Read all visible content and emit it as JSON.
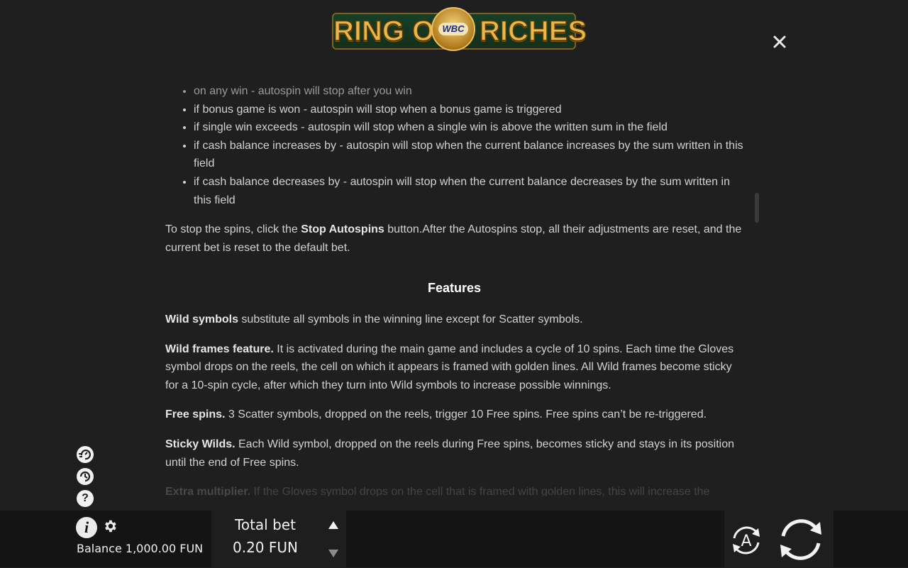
{
  "logo": {
    "left_text": "RING OF",
    "right_text": "RICHES",
    "badge_text": "WBC"
  },
  "close_icon": "close-icon",
  "rules": {
    "autospin_stop_conditions": [
      "on any win - autospin will stop after you win",
      "if bonus game is won - autospin will stop when a bonus game is triggered",
      "if single win exceeds - autospin will stop when a single win is above the written sum in the field",
      "if cash balance increases by - autospin will stop when the current balance increases by the sum written in this field",
      "if cash balance decreases by - autospin will stop when the current balance decreases by the sum written in this field"
    ],
    "stop_text_1": "To stop the spins, click the ",
    "stop_bold": "Stop Autospins",
    "stop_text_2": " button.After the Autospins stop, all their adjustments are reset, and the current bet is reset to the default bet.",
    "features_heading": "Features",
    "wild_bold": "Wild symbols",
    "wild_text": " substitute all symbols in the winning line except for Scatter symbols.",
    "frames_bold": "Wild frames feature.",
    "frames_text": " It is activated during the main game and includes a cycle of 10 spins. Each time the Gloves symbol drops on the reels, the cell on which it appears is framed with golden lines. All Wild frames become sticky for a 10-spin cycle, after which they turn into Wild symbols to increase possible winnings.",
    "free_bold": "Free spins.",
    "free_text": " 3 Scatter symbols, dropped on the reels, trigger 10 Free spins. Free spins can’t be re-triggered.",
    "sticky_bold": "Sticky Wilds.",
    "sticky_text": " Each Wild symbol, dropped on the reels during Free spins, becomes sticky and stays in its position until the end of Free spins.",
    "multi_bold": "Extra multiplier.",
    "multi_text": " If the Gloves symbol drops on the cell that is framed with golden lines, this will increase the"
  },
  "side_icons": {
    "turbo": "turbo-icon",
    "quickspin": "quickspin-icon",
    "help": "?"
  },
  "bottom": {
    "info_label": "i",
    "balance_text": "Balance 1,000.00 FUN",
    "bet_label": "Total bet",
    "bet_value": "0.20 FUN",
    "auto_label": "A"
  },
  "colors": {
    "background": "#1f1f1f",
    "text": "#d2d2d2",
    "heading": "#ffffff",
    "logo_gold": "#e8b84a",
    "logo_green": "#145a2c"
  }
}
